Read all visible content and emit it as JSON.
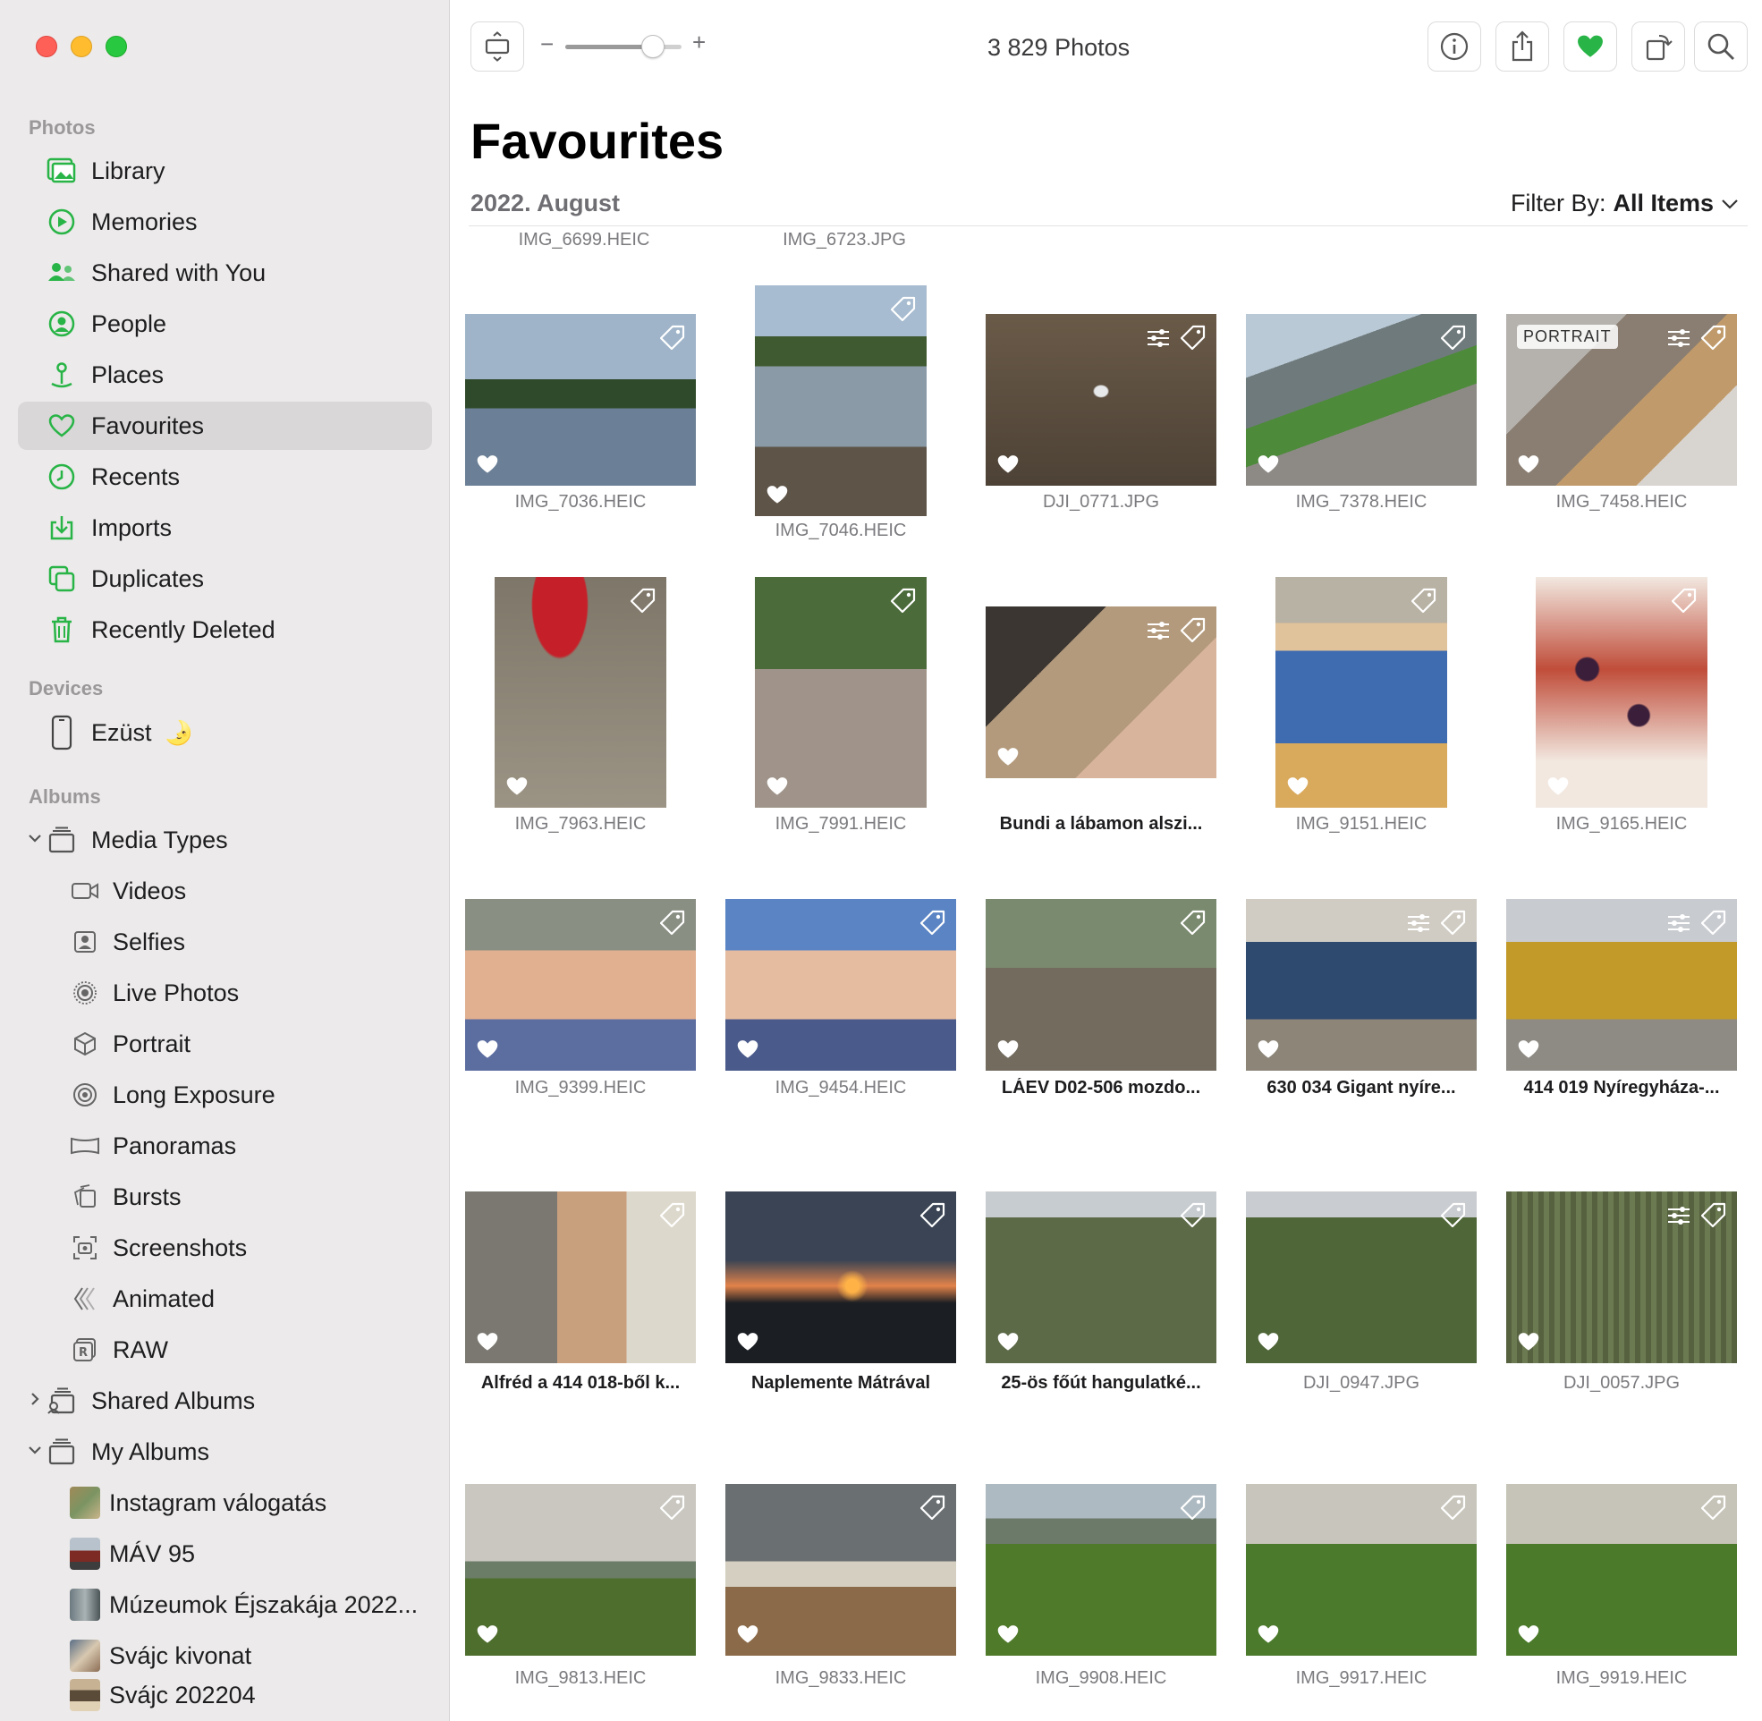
{
  "sidebar": {
    "sections": {
      "photos": "Photos",
      "devices": "Devices",
      "albums": "Albums"
    },
    "photos_items": [
      {
        "label": "Library",
        "icon": "library-icon"
      },
      {
        "label": "Memories",
        "icon": "memories-icon"
      },
      {
        "label": "Shared with You",
        "icon": "shared-with-you-icon"
      },
      {
        "label": "People",
        "icon": "people-icon"
      },
      {
        "label": "Places",
        "icon": "places-icon"
      },
      {
        "label": "Favourites",
        "icon": "heart-icon",
        "active": true
      },
      {
        "label": "Recents",
        "icon": "clock-icon"
      },
      {
        "label": "Imports",
        "icon": "import-icon"
      },
      {
        "label": "Duplicates",
        "icon": "duplicates-icon"
      },
      {
        "label": "Recently Deleted",
        "icon": "trash-icon"
      }
    ],
    "device": {
      "label": "Ezüst",
      "emoji": "🌛"
    },
    "media_types": {
      "label": "Media Types",
      "items": [
        "Videos",
        "Selfies",
        "Live Photos",
        "Portrait",
        "Long Exposure",
        "Panoramas",
        "Bursts",
        "Screenshots",
        "Animated",
        "RAW"
      ]
    },
    "shared_albums": "Shared Albums",
    "my_albums": {
      "label": "My Albums",
      "items": [
        "Instagram válogatás",
        "MÁV 95",
        "Múzeumok Éjszakája 2022...",
        "Svájc kivonat",
        "Svájc 202204"
      ]
    }
  },
  "toolbar": {
    "photo_count": "3 829 Photos",
    "zoom_minus": "−",
    "zoom_plus": "+",
    "zoom_level": 0.75
  },
  "main": {
    "title": "Favourites",
    "date_header": "2022. August",
    "filter_label": "Filter By:",
    "filter_value": "All Items",
    "top_captions": [
      "IMG_6699.HEIC",
      "IMG_6723.JPG"
    ]
  },
  "colors": {
    "accent_green": "#28b446",
    "sidebar_bg": "#eceaea",
    "active_bg": "#d9d7d7"
  },
  "photos": [
    {
      "caption": "IMG_7036.HEIC",
      "title": false
    },
    {
      "caption": "IMG_7046.HEIC",
      "title": false
    },
    {
      "caption": "DJI_0771.JPG",
      "title": false
    },
    {
      "caption": "IMG_7378.HEIC",
      "title": false
    },
    {
      "caption": "IMG_7458.HEIC",
      "title": false,
      "badge": "PORTRAIT"
    },
    {
      "caption": "IMG_7963.HEIC",
      "title": false
    },
    {
      "caption": "IMG_7991.HEIC",
      "title": false
    },
    {
      "caption": "Bundi a lábamon alszi...",
      "title": true
    },
    {
      "caption": "IMG_9151.HEIC",
      "title": false
    },
    {
      "caption": "IMG_9165.HEIC",
      "title": false
    },
    {
      "caption": "IMG_9399.HEIC",
      "title": false
    },
    {
      "caption": "IMG_9454.HEIC",
      "title": false
    },
    {
      "caption": "LÁEV D02-506 mozdo...",
      "title": true
    },
    {
      "caption": "630 034 Gigant nyíre...",
      "title": true
    },
    {
      "caption": "414 019 Nyíregyháza-...",
      "title": true
    },
    {
      "caption": "Alfréd a 414 018-ből k...",
      "title": true
    },
    {
      "caption": "Naplemente Mátrával",
      "title": true
    },
    {
      "caption": "25-ös főút hangulatké...",
      "title": true
    },
    {
      "caption": "DJI_0947.JPG",
      "title": false
    },
    {
      "caption": "DJI_0057.JPG",
      "title": false
    },
    {
      "caption": "IMG_9813.HEIC",
      "title": false
    },
    {
      "caption": "IMG_9833.HEIC",
      "title": false
    },
    {
      "caption": "IMG_9908.HEIC",
      "title": false
    },
    {
      "caption": "IMG_9917.HEIC",
      "title": false
    },
    {
      "caption": "IMG_9919.HEIC",
      "title": false
    }
  ]
}
